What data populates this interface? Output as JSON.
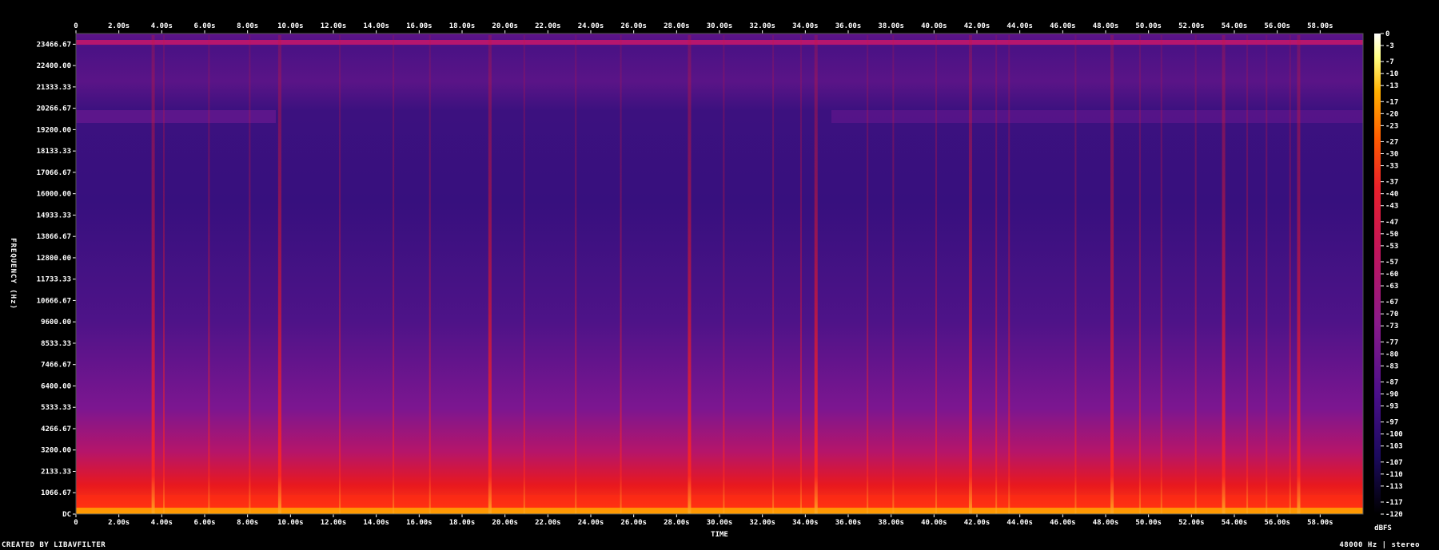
{
  "chart_data": {
    "type": "heatmap",
    "title": "",
    "xlabel": "TIME",
    "ylabel": "FREQUENCY (Hz)",
    "colorbar_label": "dBFS",
    "x_ticks": [
      "0",
      "2.00s",
      "4.00s",
      "6.00s",
      "8.00s",
      "10.00s",
      "12.00s",
      "14.00s",
      "16.00s",
      "18.00s",
      "20.00s",
      "22.00s",
      "24.00s",
      "26.00s",
      "28.00s",
      "30.00s",
      "32.00s",
      "34.00s",
      "36.00s",
      "38.00s",
      "40.00s",
      "42.00s",
      "44.00s",
      "46.00s",
      "48.00s",
      "50.00s",
      "52.00s",
      "54.00s",
      "56.00s",
      "58.00s"
    ],
    "y_ticks": [
      "DC",
      "1066.67",
      "2133.33",
      "3200.00",
      "4266.67",
      "5333.33",
      "6400.00",
      "7466.67",
      "8533.33",
      "9600.00",
      "10666.67",
      "11733.33",
      "12800.00",
      "13866.67",
      "14933.33",
      "16000.00",
      "17066.67",
      "18133.33",
      "19200.00",
      "20266.67",
      "21333.33",
      "22400.00",
      "23466.67"
    ],
    "colorbar_ticks": [
      "0",
      "-3",
      "-7",
      "-10",
      "-13",
      "-17",
      "-20",
      "-23",
      "-27",
      "-30",
      "-33",
      "-37",
      "-40",
      "-43",
      "-47",
      "-50",
      "-53",
      "-57",
      "-60",
      "-63",
      "-67",
      "-70",
      "-73",
      "-77",
      "-80",
      "-83",
      "-87",
      "-90",
      "-93",
      "-97",
      "-100",
      "-103",
      "-107",
      "-110",
      "-113",
      "-117",
      "-120"
    ],
    "xlim": [
      0,
      60
    ],
    "ylim": [
      0,
      24000
    ],
    "zlim": [
      -120,
      0
    ],
    "colormap": [
      "#000000",
      "#1b0a5e",
      "#4a0f8a",
      "#8a1a8a",
      "#c2155a",
      "#e8202a",
      "#ff5a00",
      "#ffb000",
      "#ffff80",
      "#ffffff"
    ],
    "transients_s": [
      3.6,
      4.1,
      6.2,
      8.1,
      9.5,
      12.3,
      14.8,
      16.5,
      19.3,
      20.9,
      23.3,
      25.4,
      28.6,
      30.2,
      32.5,
      33.8,
      34.5,
      36.9,
      38.1,
      40.1,
      41.7,
      42.9,
      43.5,
      46.6,
      48.3,
      49.6,
      50.6,
      52.2,
      53.5,
      54.6,
      55.5,
      56.6,
      57.0
    ]
  },
  "footer": {
    "left": "CREATED BY LIBAVFILTER",
    "right": "48000 Hz | stereo"
  }
}
